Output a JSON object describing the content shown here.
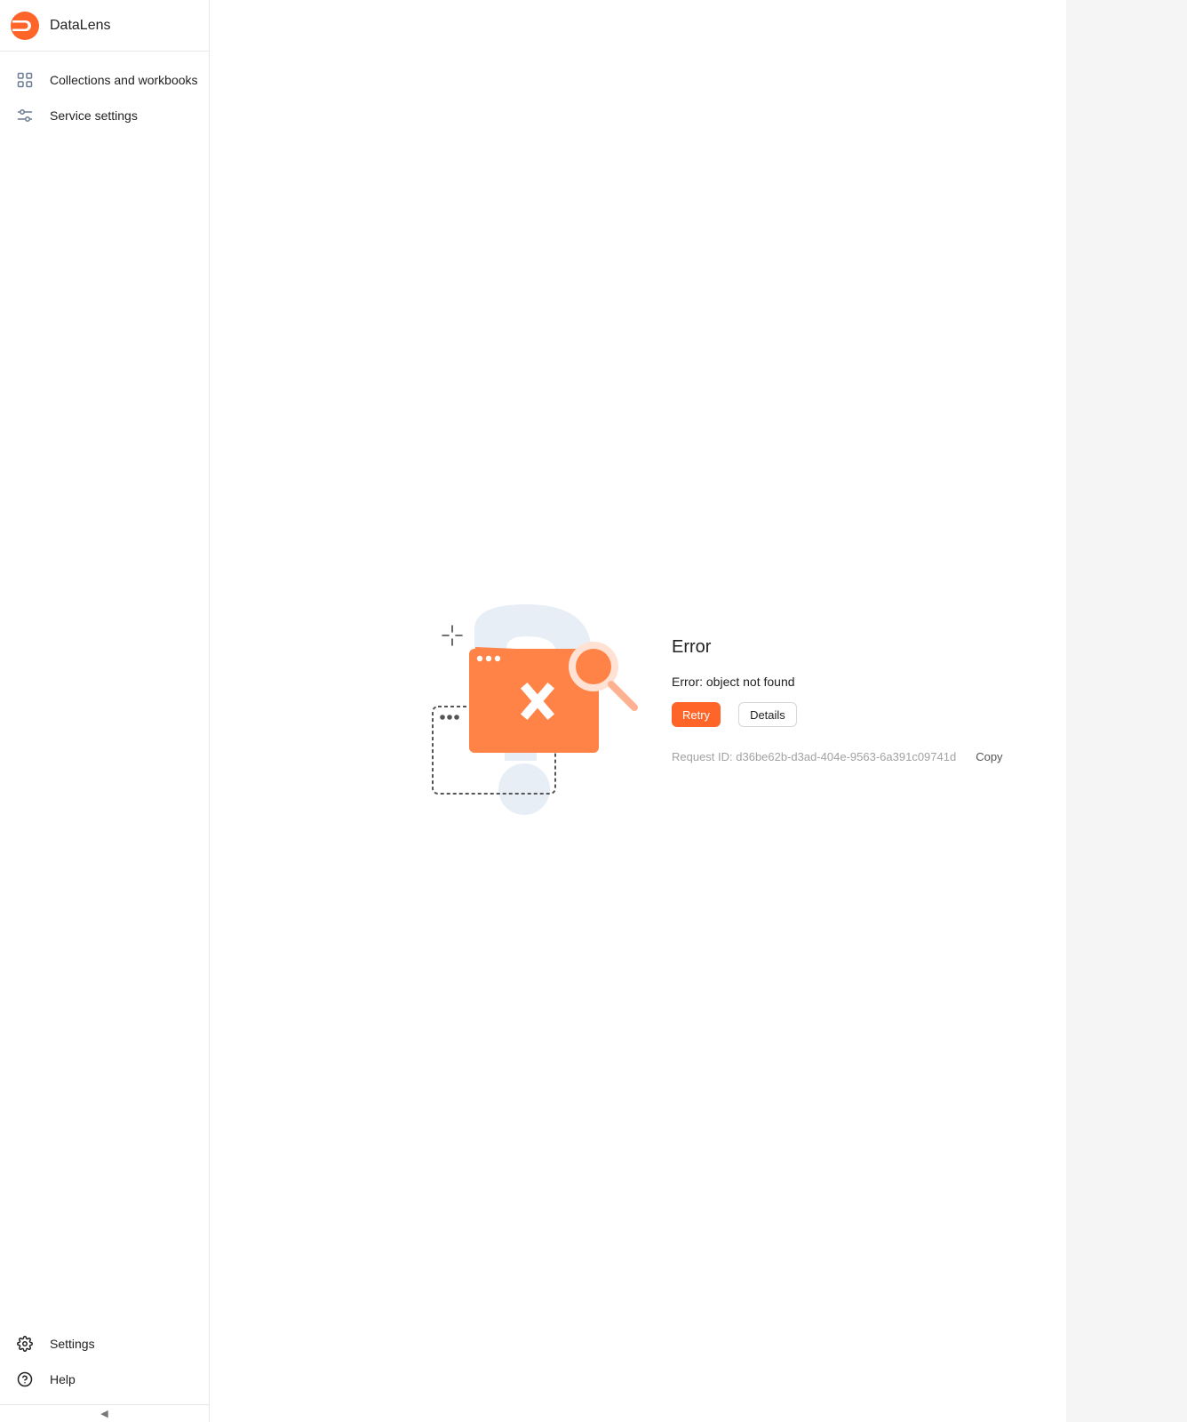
{
  "app": {
    "name": "DataLens",
    "brand_color": "#ff6428"
  },
  "sidebar": {
    "items": [
      {
        "label": "Collections and workbooks",
        "icon": "grid-icon"
      },
      {
        "label": "Service settings",
        "icon": "sliders-icon"
      }
    ],
    "bottom_items": [
      {
        "label": "Settings",
        "icon": "gear-icon"
      },
      {
        "label": "Help",
        "icon": "help-circle-icon"
      }
    ],
    "collapse_glyph": "◀"
  },
  "error": {
    "title": "Error",
    "message": "Error: object not found",
    "retry_label": "Retry",
    "details_label": "Details",
    "request_id": "Request ID: d36be62b-d3ad-404e-9563-6a391c09741d",
    "copy_label": "Copy"
  }
}
